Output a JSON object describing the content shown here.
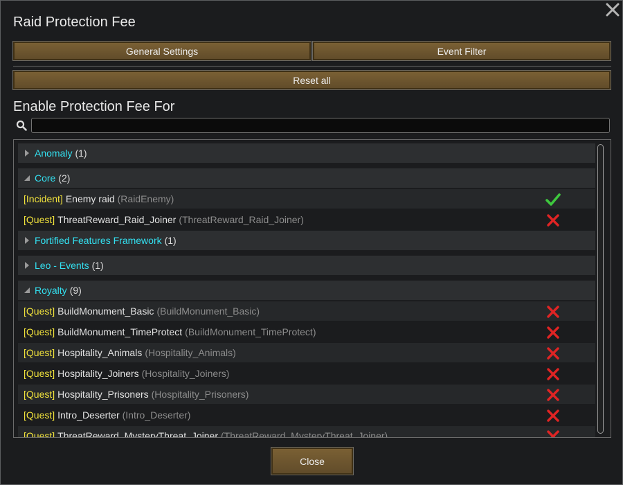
{
  "window": {
    "title": "Raid Protection Fee"
  },
  "tabs": [
    {
      "label": "General Settings"
    },
    {
      "label": "Event Filter"
    }
  ],
  "reset_label": "Reset all",
  "section_title": "Enable Protection Fee For",
  "search": {
    "value": "",
    "placeholder": ""
  },
  "groups": {
    "anomaly": {
      "name": "Anomaly",
      "count": "(1)"
    },
    "core": {
      "name": "Core",
      "count": "(2)"
    },
    "fortified": {
      "name": "Fortified Features Framework",
      "count": "(1)"
    },
    "leo": {
      "name": "Leo - Events",
      "count": "(1)"
    },
    "royalty": {
      "name": "Royalty",
      "count": "(9)"
    }
  },
  "core_items": [
    {
      "tag": "[Incident]",
      "name": "Enemy raid",
      "def": "(RaidEnemy)",
      "enabled": true
    },
    {
      "tag": "[Quest]",
      "name": "ThreatReward_Raid_Joiner",
      "def": "(ThreatReward_Raid_Joiner)",
      "enabled": false
    }
  ],
  "royalty_items": [
    {
      "tag": "[Quest]",
      "name": "BuildMonument_Basic",
      "def": "(BuildMonument_Basic)",
      "enabled": false
    },
    {
      "tag": "[Quest]",
      "name": "BuildMonument_TimeProtect",
      "def": "(BuildMonument_TimeProtect)",
      "enabled": false
    },
    {
      "tag": "[Quest]",
      "name": "Hospitality_Animals",
      "def": "(Hospitality_Animals)",
      "enabled": false
    },
    {
      "tag": "[Quest]",
      "name": "Hospitality_Joiners",
      "def": "(Hospitality_Joiners)",
      "enabled": false
    },
    {
      "tag": "[Quest]",
      "name": "Hospitality_Prisoners",
      "def": "(Hospitality_Prisoners)",
      "enabled": false
    },
    {
      "tag": "[Quest]",
      "name": "Intro_Deserter",
      "def": "(Intro_Deserter)",
      "enabled": false
    },
    {
      "tag": "[Quest]",
      "name": "ThreatReward_MysteryThreat_Joiner",
      "def": "(ThreatReward_MysteryThreat_Joiner)",
      "enabled": false
    }
  ],
  "close_label": "Close",
  "colors": {
    "accent_cyan": "#33e0f0",
    "tag_yellow": "#f2e33c",
    "check_green": "#3ec83e",
    "cross_red": "#e02424",
    "button_brown": "#6f5530"
  },
  "icons": {
    "close": "close-icon",
    "search": "search-icon",
    "expand": "triangle-right-icon",
    "collapse": "triangle-down-icon",
    "enabled": "checkmark-icon",
    "disabled": "cross-icon"
  }
}
